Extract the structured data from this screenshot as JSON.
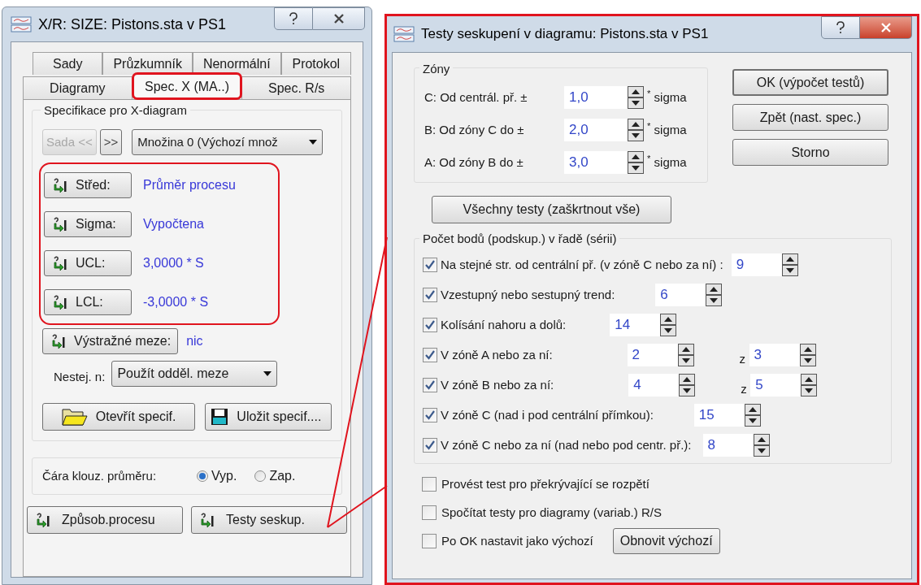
{
  "left_window": {
    "title": "X/R: SIZE: Pistons.sta v PS1",
    "tab_rows": [
      [
        {
          "label": "Sady",
          "selected": false,
          "annotated": false
        },
        {
          "label": "Průzkumník",
          "selected": false,
          "annotated": false
        },
        {
          "label": "Nenormální",
          "selected": false,
          "annotated": false
        },
        {
          "label": "Protokol",
          "selected": false,
          "annotated": false
        }
      ],
      [
        {
          "label": "Diagramy",
          "selected": false,
          "annotated": false
        },
        {
          "label": "Spec. X (MA..)",
          "selected": true,
          "annotated": true
        },
        {
          "label": "Spec. R/s",
          "selected": false,
          "annotated": false
        }
      ]
    ],
    "group_title": "Specifikace pro X-diagram",
    "set_nav": [
      {
        "label": "Sada <<",
        "disabled": true
      },
      {
        "label": ">>",
        "disabled": false
      }
    ],
    "set_dropdown": "Množina 0 (Výchozí množ",
    "limits_annotated": true,
    "limits": [
      {
        "label": "Střed:",
        "value": "Průměr procesu"
      },
      {
        "label": "Sigma:",
        "value": "Vypočtena"
      },
      {
        "label": "UCL:",
        "value": "3,0000 * S"
      },
      {
        "label": "LCL:",
        "value": "-3,0000 * S"
      }
    ],
    "warning": {
      "label": "Výstražné meze:",
      "value": "nic"
    },
    "unequal_n": {
      "label": "Nestej. n:",
      "value": "Použít odděl. meze"
    },
    "file_buttons": [
      {
        "kind": "open",
        "label": "Otevřít specif."
      },
      {
        "kind": "save",
        "label": "Uložit specif...."
      }
    ],
    "moving_avg": {
      "label": "Čára klouz. průměru:",
      "options": [
        {
          "label": "Vyp.",
          "selected": true
        },
        {
          "label": "Zap.",
          "selected": false
        }
      ]
    },
    "bottom_buttons": [
      {
        "label": "Způsob.procesu",
        "callout": false
      },
      {
        "label": "Testy seskup.",
        "callout": true
      }
    ]
  },
  "right_window": {
    "title": "Testy seskupení v diagramu: Pistons.sta v PS1",
    "annotated": true,
    "zones": {
      "title": "Zóny",
      "rows": [
        {
          "label": "C: Od centrál. př. ±",
          "value": "1,0",
          "unit": "$^{*}$ sigma"
        },
        {
          "label": "B: Od zóny C do ±",
          "value": "2,0",
          "unit": "$^{*}$ sigma"
        },
        {
          "label": "A: Od zóny B do ±",
          "value": "3,0",
          "unit": "$^{*}$ sigma"
        }
      ]
    },
    "buttons": [
      {
        "label": "OK (výpočet testů)",
        "default": true
      },
      {
        "label": "Zpět (nast. spec.)",
        "default": false
      },
      {
        "label": "Storno",
        "default": false
      }
    ],
    "check_all": "Všechny testy (zaškrtnout vše)",
    "runs": {
      "title": "Počet bodů (podskup.) v řadě (sérii)",
      "tests": [
        {
          "label": "Na stejné str. od centrální př. (v zóně C nebo za ní) :",
          "checked": true,
          "value": "9"
        },
        {
          "label": "Vzestupný nebo sestupný trend:",
          "checked": true,
          "value": "6"
        },
        {
          "label": "Kolísání nahoru a dolů:",
          "checked": true,
          "value": "14"
        },
        {
          "label": "V zóně A nebo za ní:",
          "checked": true,
          "value": "2",
          "of_label": "z",
          "of_value": "3"
        },
        {
          "label": "V zóně B nebo za ní:",
          "checked": true,
          "value": "4",
          "of_label": "z",
          "of_value": "5"
        },
        {
          "label": "V zóně C (nad i pod centrální přímkou):",
          "checked": true,
          "value": "15"
        },
        {
          "label": "V zóně C nebo za ní (nad nebo pod centr. př.):",
          "checked": true,
          "value": "8"
        }
      ]
    },
    "options": [
      {
        "label": "Provést test pro překrývající se rozpětí",
        "checked": false
      },
      {
        "label": "Spočítat testy pro diagramy (variab.) R/S",
        "checked": false
      },
      {
        "label": "Po OK nastavit jako výchozí",
        "checked": false
      }
    ],
    "reset_button": "Obnovit výchozí"
  }
}
